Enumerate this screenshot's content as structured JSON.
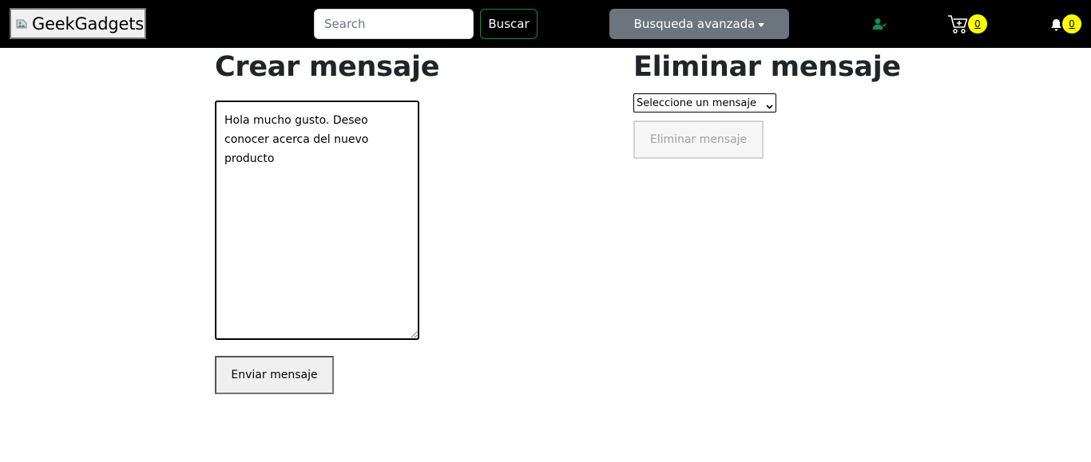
{
  "navbar": {
    "brand": {
      "text": "GeekGadgets",
      "image_icon": "broken-image-icon"
    },
    "search": {
      "placeholder": "Search",
      "value": ""
    },
    "search_button": "Buscar",
    "advanced_search_button": "Busqueda avanzada",
    "user_icon": "user-icon",
    "cart": {
      "icon": "cart-icon",
      "count": "0"
    },
    "notifications": {
      "icon": "bell-icon",
      "count": "0"
    },
    "colors": {
      "background": "#000000",
      "search_button_border": "#198754",
      "advanced_bg": "#6c757d",
      "badge_bg": "#ffff00",
      "user_icon": "#198754"
    }
  },
  "create_message": {
    "title": "Crear mensaje",
    "message_text": "Hola mucho gusto. Deseo conocer acerca del nuevo producto",
    "send_button": "Enviar mensaje"
  },
  "delete_message": {
    "title": "Eliminar mensaje",
    "select_value": "Seleccione un mensaje",
    "delete_button": "Eliminar mensaje",
    "delete_button_disabled": true
  }
}
